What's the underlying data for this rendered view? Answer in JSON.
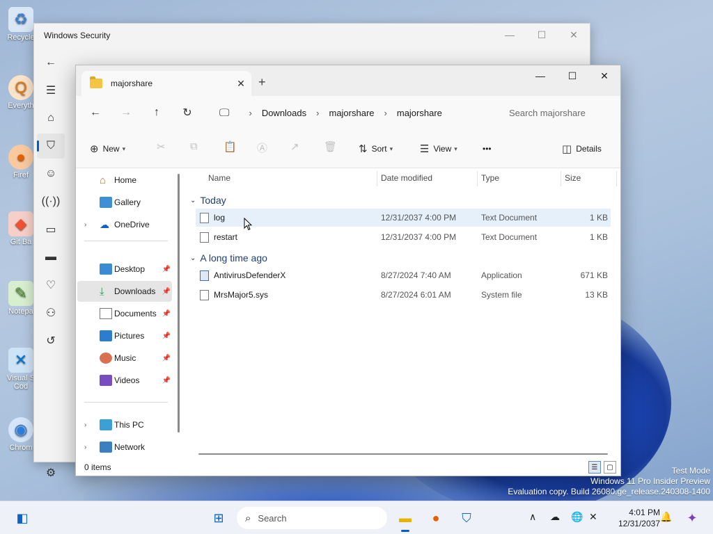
{
  "desktop": {
    "icons": [
      {
        "label": "Recycle",
        "glyph": "♻",
        "color": "#4a8fd6"
      },
      {
        "label": "Everyth",
        "glyph": "Q",
        "color": "#f08a24"
      },
      {
        "label": "Firef",
        "glyph": "●",
        "color": "#e66000"
      },
      {
        "label": "Git Ba",
        "glyph": "◆",
        "color": "#f05033"
      },
      {
        "label": "Notepa",
        "glyph": "✎",
        "color": "#6bb34a"
      },
      {
        "label": "Visual S Cod",
        "glyph": "✕",
        "color": "#0078d4"
      },
      {
        "label": "Chrom",
        "glyph": "◉",
        "color": "#2a7de1"
      }
    ]
  },
  "security_window": {
    "title": "Windows Security",
    "controls": {
      "minimize": "—",
      "maximize": "☐",
      "close": "✕"
    }
  },
  "explorer": {
    "tab_label": "majorshare",
    "tab_close": "✕",
    "new_tab": "+",
    "window_controls": {
      "minimize": "—",
      "maximize": "☐",
      "close": "✕"
    },
    "breadcrumb": [
      "Downloads",
      "majorshare",
      "majorshare"
    ],
    "search_placeholder": "Search majorshare",
    "commands": {
      "new": "New",
      "sort": "Sort",
      "view": "View",
      "more": "•••",
      "details": "Details"
    },
    "nav": {
      "home": "Home",
      "gallery": "Gallery",
      "onedrive": "OneDrive",
      "desktop": "Desktop",
      "downloads": "Downloads",
      "documents": "Documents",
      "pictures": "Pictures",
      "music": "Music",
      "videos": "Videos",
      "this_pc": "This PC",
      "network": "Network"
    },
    "columns": {
      "name": "Name",
      "date": "Date modified",
      "type": "Type",
      "size": "Size"
    },
    "groups": {
      "today": "Today",
      "long_ago": "A long time ago"
    },
    "files_today": [
      {
        "name": "log",
        "date": "12/31/2037 4:00 PM",
        "type": "Text Document",
        "size": "1 KB"
      },
      {
        "name": "restart",
        "date": "12/31/2037 4:00 PM",
        "type": "Text Document",
        "size": "1 KB"
      }
    ],
    "files_old": [
      {
        "name": "AntivirusDefenderX",
        "date": "8/27/2024 7:40 AM",
        "type": "Application",
        "size": "671 KB"
      },
      {
        "name": "MrsMajor5.sys",
        "date": "8/27/2024 6:01 AM",
        "type": "System file",
        "size": "13 KB"
      }
    ],
    "status": "0 items"
  },
  "watermark": {
    "line1": "Test Mode",
    "line2": "Windows 11 Pro Insider Preview",
    "line3": "Evaluation copy. Build 26080.ge_release.240308-1400"
  },
  "taskbar": {
    "search_label": "Search",
    "time": "4:01 PM",
    "date": "12/31/2037"
  },
  "colors": {
    "accent": "#005fb8",
    "selection": "#e5f0fb",
    "group_header": "#1f3e73"
  }
}
